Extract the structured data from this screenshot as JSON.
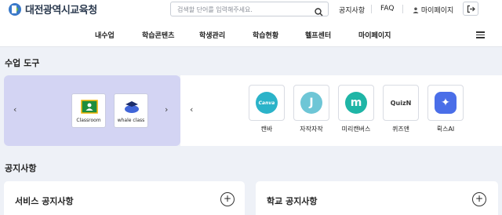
{
  "header": {
    "logo_text": "대전광역시교육청",
    "search_placeholder": "검색할 단어를 입력해주세요.",
    "links": [
      "공지사항",
      "FAQ",
      "마이페이지"
    ]
  },
  "nav": {
    "items": [
      "내수업",
      "학습콘텐츠",
      "학생관리",
      "학습현황",
      "헬프센터",
      "마이페이지"
    ]
  },
  "tools_section": {
    "title": "수업 도구",
    "featured": [
      {
        "label": "Classroom",
        "icon": "google-classroom-icon"
      },
      {
        "label": "whale class",
        "icon": "whale-class-icon"
      }
    ],
    "apps": [
      {
        "label": "캔바",
        "icon": "canva-icon",
        "mark": "Canva",
        "color": "#2bb3c9"
      },
      {
        "label": "자작자작",
        "icon": "jajak-icon",
        "mark": "J",
        "color": "#6ec6d6"
      },
      {
        "label": "미리캔버스",
        "icon": "miricanvas-icon",
        "mark": "m",
        "color": "#1fb5a6"
      },
      {
        "label": "퀴즈앤",
        "icon": "quizn-icon",
        "mark": "QuizN",
        "color": "#333333"
      },
      {
        "label": "뤽스AI",
        "icon": "wrtn-ai-icon",
        "mark": "✦",
        "color": "#4a6ee8"
      }
    ]
  },
  "notice_section": {
    "title": "공지사항",
    "cards": [
      "서비스 공지사항",
      "학교 공지사항"
    ]
  },
  "colors": {
    "panel": "#d3d4f3",
    "page_bg": "#eef1f7"
  }
}
